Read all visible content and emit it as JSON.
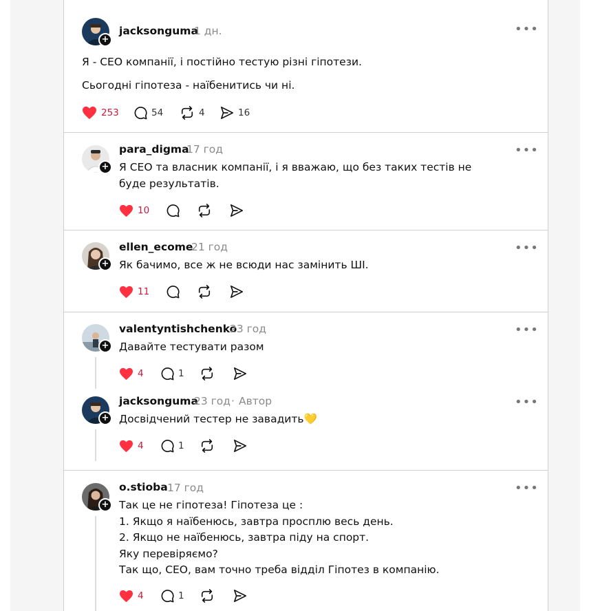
{
  "post": {
    "username": "jacksonguma",
    "time": "1 дн.",
    "lines": [
      "Я - CEO компанії, і постійно тестую різні гіпотези.",
      "Сьогодні гіпотеза - наїбенитись чи ні."
    ],
    "likes": "253",
    "comments": "54",
    "reposts": "4",
    "shares": "16"
  },
  "replies": [
    {
      "username": "para_digma",
      "time": "17 год",
      "text": "Я CEO та власник компанії, і я вважаю, що без таких тестів не\nбуде результатів.",
      "likes": "10"
    },
    {
      "username": "ellen_ecome",
      "time": "21 год",
      "text": "Як бачимо, все ж не всюди нас замінить ШІ.",
      "likes": "11"
    },
    {
      "username": "valentyntishchenko",
      "time": "23 год",
      "text": "Давайте тестувати разом",
      "likes": "4",
      "comments": "1"
    },
    {
      "username": "jacksonguma",
      "time": "23 год",
      "author_label": "Автор",
      "text": "Досвідчений тестер не завадить💛",
      "likes": "4",
      "comments": "1"
    },
    {
      "username": "o.stioba",
      "time": "17 год",
      "text": "Так це не гіпотеза! Гіпотеза це :\n1. Якщо я наїбенюсь, завтра просплю весь день.\n2. Якщо не наїбенюсь, завтра піду на спорт.\nЯку перевіряємо?\nТак що, CEO, вам точно треба відділ Гіпотез в компанію.",
      "likes": "4",
      "comments": "1"
    }
  ],
  "icons": {
    "like": "heart-filled-icon",
    "comment": "speech-bubble-icon",
    "repost": "repost-arrows-icon",
    "share": "paper-plane-icon",
    "more": "more-dots-icon",
    "follow": "plus-icon"
  },
  "colors": {
    "like": "#ff3040",
    "like_count": "#c91b3a",
    "muted": "#8a8a8a"
  }
}
